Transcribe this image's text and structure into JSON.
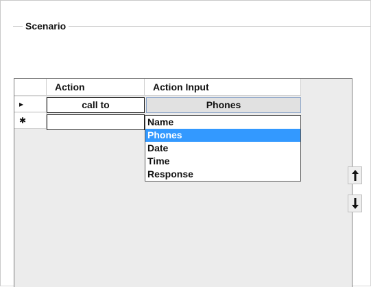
{
  "group": {
    "title": "Scenario"
  },
  "grid": {
    "columns": [
      "Action",
      "Action Input"
    ],
    "rows": [
      {
        "marker": "▸",
        "action": "call to",
        "action_input": "Phones"
      },
      {
        "marker": "✱",
        "action": "",
        "action_input": ""
      }
    ]
  },
  "dropdown": {
    "options": [
      "Name",
      "Phones",
      "Date",
      "Time",
      "Response"
    ],
    "selected": "Phones",
    "selected_color": "#3399ff"
  },
  "side_buttons": {
    "up_icon": "arrow-up-icon",
    "down_icon": "arrow-down-icon"
  }
}
